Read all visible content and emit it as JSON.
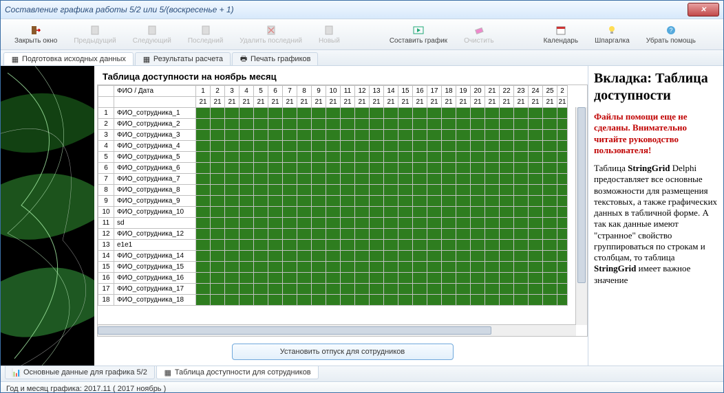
{
  "window": {
    "title": "Составление графика работы 5/2 или 5/(воскресенье + 1)",
    "close": "✕"
  },
  "toolbar": {
    "close": "Закрыть окно",
    "prev": "Предыдущий",
    "next": "Следующий",
    "last": "Последний",
    "delLast": "Удалить последний",
    "new": "Новый",
    "make": "Составить график",
    "clear": "Очистить",
    "calendar": "Календарь",
    "cheat": "Шпаргалка",
    "hideHelp": "Убрать помощь"
  },
  "topTabs": {
    "t1": "Подготовка исходных данных",
    "t2": "Результаты расчета",
    "t3": "Печать графиков"
  },
  "heading": "Таблица доступности на ноябрь месяц",
  "grid": {
    "fioHeader": "ФИО / Дата",
    "days": [
      "1",
      "2",
      "3",
      "4",
      "5",
      "6",
      "7",
      "8",
      "9",
      "10",
      "11",
      "12",
      "13",
      "14",
      "15",
      "16",
      "17",
      "18",
      "19",
      "20",
      "21",
      "22",
      "23",
      "24",
      "25",
      "2"
    ],
    "row2val": "21",
    "rows": [
      {
        "n": "1",
        "fio": "ФИО_сотрудника_1"
      },
      {
        "n": "2",
        "fio": "ФИО_сотрудника_2"
      },
      {
        "n": "3",
        "fio": "ФИО_сотрудника_3"
      },
      {
        "n": "4",
        "fio": "ФИО_сотрудника_4"
      },
      {
        "n": "5",
        "fio": "ФИО_сотрудника_5"
      },
      {
        "n": "6",
        "fio": "ФИО_сотрудника_6"
      },
      {
        "n": "7",
        "fio": "ФИО_сотрудника_7"
      },
      {
        "n": "8",
        "fio": "ФИО_сотрудника_8"
      },
      {
        "n": "9",
        "fio": "ФИО_сотрудника_9"
      },
      {
        "n": "10",
        "fio": "ФИО_сотрудника_10"
      },
      {
        "n": "11",
        "fio": "sd"
      },
      {
        "n": "12",
        "fio": "ФИО_сотрудника_12"
      },
      {
        "n": "13",
        "fio": "e1e1"
      },
      {
        "n": "14",
        "fio": "ФИО_сотрудника_14"
      },
      {
        "n": "15",
        "fio": "ФИО_сотрудника_15"
      },
      {
        "n": "16",
        "fio": "ФИО_сотрудника_16"
      },
      {
        "n": "17",
        "fio": "ФИО_сотрудника_17"
      },
      {
        "n": "18",
        "fio": "ФИО_сотрудника_18"
      }
    ]
  },
  "vacBtn": "Установить отпуск для сотрудников",
  "help": {
    "title": "Вкладка: Таблица доступности",
    "warn": "Файлы помощи еще не сделаны. Внимательно читайте руководство пользователя!",
    "body1": "Таблица ",
    "body1b": "StringGrid",
    "body2": " Delphi предоставляет все основные возможности для размещения текстовых, а также графических данных в табличной форме. А так как данные имеют \"странное\" свойство группироваться по строкам и столбцам, то таблица ",
    "body2b": "StringGrid",
    "body3": " имеет важное значение"
  },
  "bottomTabs": {
    "b1": "Основные данные для графика 5/2",
    "b2": "Таблица доступности для сотрудников"
  },
  "status": "Год и месяц графика:  2017.11  ( 2017  ноябрь )"
}
